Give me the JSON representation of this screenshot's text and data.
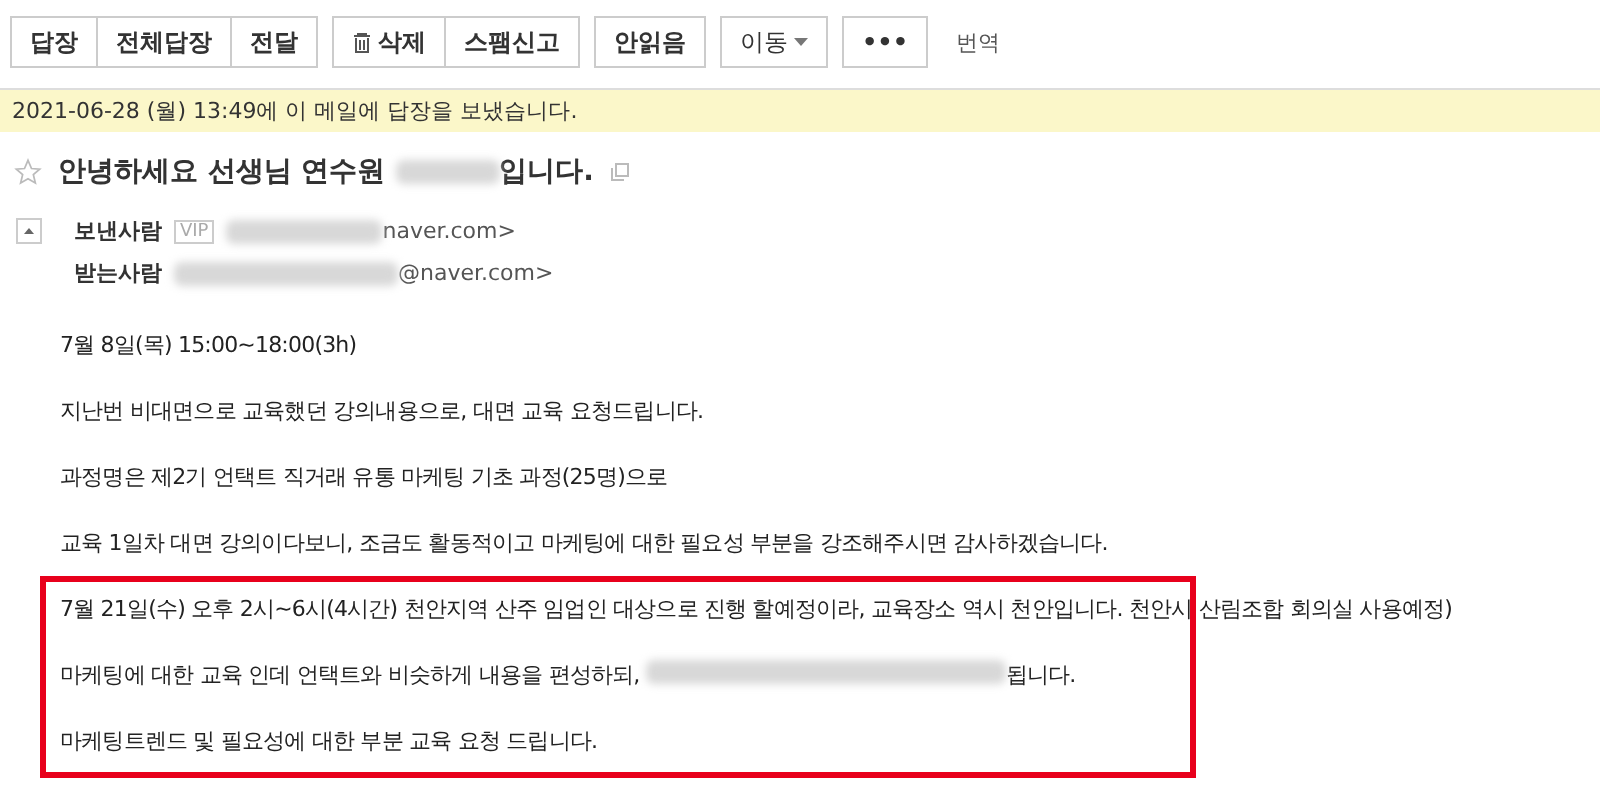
{
  "toolbar": {
    "groups": [
      {
        "buttons": [
          {
            "label": "답장",
            "kind": "text"
          },
          {
            "label": "전체답장",
            "kind": "text"
          },
          {
            "label": "전달",
            "kind": "text"
          }
        ]
      },
      {
        "buttons": [
          {
            "label": "삭제",
            "kind": "trash"
          },
          {
            "label": "스팸신고",
            "kind": "text"
          }
        ]
      },
      {
        "buttons": [
          {
            "label": "안읽음",
            "kind": "text"
          }
        ]
      },
      {
        "buttons": [
          {
            "label": "이동",
            "kind": "dropdown"
          }
        ]
      },
      {
        "buttons": [
          {
            "label": "•••",
            "kind": "text"
          }
        ]
      }
    ],
    "translate": "번역"
  },
  "notice": "2021-06-28 (월) 13:49에 이 메일에 답장을 보냈습니다.",
  "subject": {
    "starred": false,
    "segments": [
      {
        "kind": "text",
        "text": "안녕하세요 선생님 연수원 "
      },
      {
        "kind": "redacted"
      },
      {
        "kind": "text",
        "text": "입니다."
      }
    ]
  },
  "headers": [
    {
      "label": "보낸사람",
      "vip": "VIP",
      "collapsible": true,
      "segments": [
        {
          "kind": "redacted"
        },
        {
          "kind": "text",
          "text": "naver.com>"
        }
      ]
    },
    {
      "label": "받는사람",
      "collapsible": false,
      "segments": [
        {
          "kind": "redacted"
        },
        {
          "kind": "text",
          "text": "@naver.com>"
        }
      ]
    }
  ],
  "body": [
    {
      "highlighted": false,
      "segments": [
        {
          "kind": "text",
          "text": "7월 8일(목) 15:00~18:00(3h)"
        }
      ]
    },
    {
      "highlighted": false,
      "segments": [
        {
          "kind": "text",
          "text": "지난번 비대면으로 교육했던 강의내용으로, 대면 교육 요청드립니다."
        }
      ]
    },
    {
      "highlighted": false,
      "segments": [
        {
          "kind": "text",
          "text": "과정명은 제2기 언택트 직거래 유통 마케팅 기초 과정(25명)으로"
        }
      ]
    },
    {
      "highlighted": false,
      "segments": [
        {
          "kind": "text",
          "text": "교육 1일차 대면 강의이다보니, 조금도 활동적이고 마케팅에 대한 필요성 부분을 강조해주시면 감사하겠습니다."
        }
      ]
    },
    {
      "highlighted": true,
      "segments": [
        {
          "kind": "text",
          "text": "7월 21일(수) 오후 2시~6시(4시간) 천안지역 산주 임업인 대상으로 진행 할예정이라, 교육장소 역시 천안입니다. 천안시 산림조합 회의실 사용예정)"
        }
      ]
    },
    {
      "highlighted": true,
      "segments": [
        {
          "kind": "text",
          "text": "마케팅에 대한 교육 인데 언택트와 비슷하게 내용을 편성하되, "
        },
        {
          "kind": "redacted"
        },
        {
          "kind": "text",
          "text": "됩니다."
        }
      ]
    },
    {
      "highlighted": true,
      "segments": [
        {
          "kind": "text",
          "text": "마케팅트렌드 및 필요성에 대한 부분 교육 요청 드립니다."
        }
      ]
    }
  ]
}
